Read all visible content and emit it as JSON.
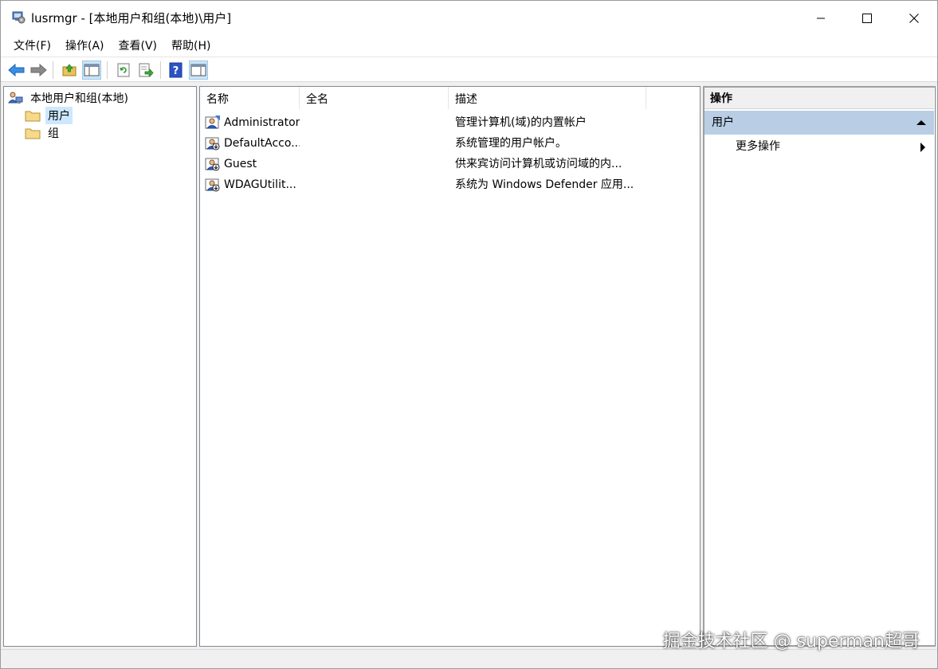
{
  "window": {
    "title": "lusrmgr - [本地用户和组(本地)\\用户]"
  },
  "menu": [
    "文件(F)",
    "操作(A)",
    "查看(V)",
    "帮助(H)"
  ],
  "toolbar": {
    "icons": [
      "back-arrow-icon",
      "forward-arrow-icon",
      "up-folder-icon",
      "show-hide-tree-icon",
      "refresh-icon",
      "export-list-icon",
      "help-icon",
      "show-hide-action-pane-icon"
    ]
  },
  "tree": {
    "root": "本地用户和组(本地)",
    "children": [
      "用户",
      "组"
    ],
    "selected": "用户"
  },
  "list": {
    "columns": [
      "名称",
      "全名",
      "描述"
    ],
    "rows": [
      {
        "name": "Administrator",
        "fullname": "",
        "description": "管理计算机(域)的内置帐户"
      },
      {
        "name": "DefaultAcco...",
        "fullname": "",
        "description": "系统管理的用户帐户。"
      },
      {
        "name": "Guest",
        "fullname": "",
        "description": "供来宾访问计算机或访问域的内..."
      },
      {
        "name": "WDAGUtilit...",
        "fullname": "",
        "description": "系统为 Windows Defender 应用..."
      }
    ]
  },
  "actions": {
    "title": "操作",
    "section": "用户",
    "more": "更多操作"
  },
  "watermark": "掘金技术社区 @ superman超哥",
  "colors": {
    "selection": "#cce8ff",
    "action_section_bg": "#b9cde5",
    "toolbar_active": "#cce4f7"
  }
}
